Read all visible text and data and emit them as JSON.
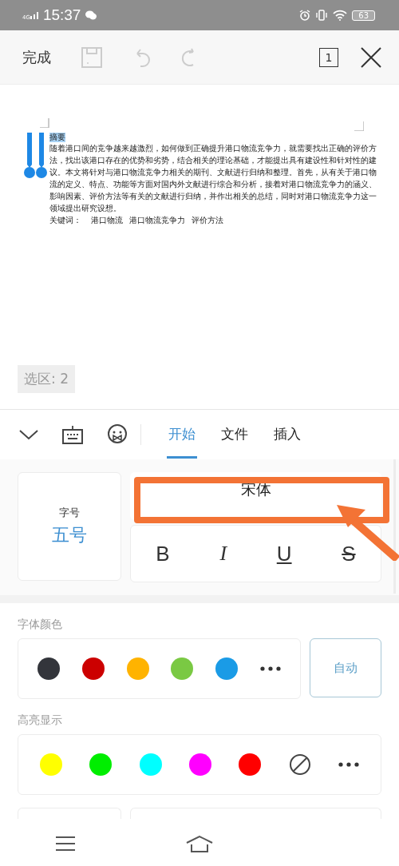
{
  "status_bar": {
    "network": "4G",
    "time": "15:37",
    "battery": "63"
  },
  "toolbar": {
    "done": "完成",
    "page_count": "1"
  },
  "document": {
    "heading": "摘要",
    "heading_selected": true,
    "lines": [
      "随着港口间的竞争越来越激烈，如何做到正确提升港口物流竞争力，就需要找出正确的评价方",
      "法，找出该港口存在的优势和劣势，结合相关的理论基础，才能提出具有建设性和针对性的建",
      "议。本文将针对与港口物流竞争力相关的期刊、文献进行归纳和整理。首先，从有关于港口物",
      "流的定义、特点、功能等方面对国内外文献进行综合和分析，接着对港口物流竞争力的涵义、",
      "影响因素、评价方法等有关的文献进行归纳，并作出相关的总结，同时对港口物流竞争力这一",
      "领域提出研究设想。"
    ],
    "keywords_label": "关键词：",
    "keywords": [
      "港口物流",
      "港口物流竞争力",
      "评价方法"
    ]
  },
  "selection_badge": "选区: 2",
  "tabs": [
    {
      "label": "开始",
      "selected": true
    },
    {
      "label": "文件",
      "selected": false
    },
    {
      "label": "插入",
      "selected": false
    }
  ],
  "font_size": {
    "label": "字号",
    "value": "五号"
  },
  "font_name": {
    "value": "宋体",
    "highlighted": true
  },
  "style_buttons": [
    {
      "kind": "bold",
      "label": "B"
    },
    {
      "kind": "italic",
      "label": "I"
    },
    {
      "kind": "underline",
      "label": "U"
    },
    {
      "kind": "strike",
      "label": "S"
    }
  ],
  "font_color": {
    "label": "字体颜色",
    "swatches": [
      {
        "kind": "color",
        "color": "#33353b"
      },
      {
        "kind": "color",
        "color": "#cc0000"
      },
      {
        "kind": "color",
        "color": "#ffb300"
      },
      {
        "kind": "color",
        "color": "#7ac943"
      },
      {
        "kind": "color",
        "color": "#1a9be6"
      },
      {
        "kind": "more"
      }
    ],
    "auto": "自动"
  },
  "highlight": {
    "label": "高亮显示",
    "swatches": [
      {
        "kind": "color",
        "color": "#ffff00"
      },
      {
        "kind": "color",
        "color": "#00ee00"
      },
      {
        "kind": "color",
        "color": "#00ffff"
      },
      {
        "kind": "color",
        "color": "#ff00ff"
      },
      {
        "kind": "color",
        "color": "#ff0000"
      },
      {
        "kind": "none"
      },
      {
        "kind": "more"
      }
    ]
  }
}
